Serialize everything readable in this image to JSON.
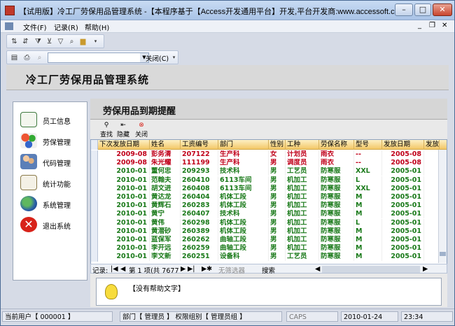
{
  "window": {
    "title": "【试用版】冷工厂劳保用品管理系统 -【本程序基于【Access开发通用平台】开发,平台开发商:www.accessoft.com】-[控...",
    "min": "–",
    "max": "□",
    "close": "✕"
  },
  "menu": {
    "file": "文件(F)",
    "record": "记录(R)",
    "help": "帮助(H)",
    "mdi_min": "_",
    "mdi_restore": "❐",
    "mdi_close": "✕"
  },
  "toolbar2": {
    "close_label": "关闭(C)"
  },
  "app_title": "冷工厂劳保用品管理系统",
  "nav": [
    {
      "label": "员工信息",
      "icon": "certificate-icon"
    },
    {
      "label": "劳保管理",
      "icon": "molecule-icon"
    },
    {
      "label": "代码管理",
      "icon": "users-icon"
    },
    {
      "label": "统计功能",
      "icon": "pencil-chart-icon"
    },
    {
      "label": "系统管理",
      "icon": "globe-icon"
    },
    {
      "label": "退出系统",
      "icon": "exit-icon"
    }
  ],
  "pane": {
    "title": "劳保用品到期提醒",
    "actions": [
      {
        "label": "查找"
      },
      {
        "label": "隐藏"
      },
      {
        "label": "关闭"
      }
    ]
  },
  "grid": {
    "columns": [
      "下次发放日期",
      "姓名",
      "工资编号",
      "部门",
      "性别",
      "工种",
      "劳保名称",
      "型号",
      "发放日期",
      "发放"
    ],
    "rows": [
      [
        "2009-08",
        "彭务清",
        "207122",
        "生产科",
        "女",
        "计划员",
        "雨衣",
        "--",
        "2005-08"
      ],
      [
        "2009-08",
        "朱光耀",
        "111199",
        "生产科",
        "男",
        "调度员",
        "雨衣",
        "--",
        "2005-08"
      ],
      [
        "2010-01",
        "董何忠",
        "209293",
        "技术科",
        "男",
        "工艺员",
        "防寒服",
        "XXL",
        "2005-01"
      ],
      [
        "2010-01",
        "范翰夫",
        "260410",
        "6113车间",
        "男",
        "机加工",
        "防寒服",
        "L",
        "2005-01"
      ],
      [
        "2010-01",
        "胡文进",
        "260408",
        "6113车间",
        "男",
        "机加工",
        "防寒服",
        "XXL",
        "2005-01"
      ],
      [
        "2010-01",
        "黄达龙",
        "260404",
        "机体工段",
        "男",
        "机加工",
        "防寒服",
        "M",
        "2005-01"
      ],
      [
        "2010-01",
        "黄辉石",
        "260283",
        "机体工段",
        "男",
        "机加工",
        "防寒服",
        "M",
        "2005-01"
      ],
      [
        "2010-01",
        "黄宁",
        "260407",
        "技术科",
        "男",
        "机加工",
        "防寒服",
        "M",
        "2005-01"
      ],
      [
        "2010-01",
        "黄伟",
        "260298",
        "机体工段",
        "男",
        "机加工",
        "防寒服",
        "L",
        "2005-01"
      ],
      [
        "2010-01",
        "黄潜砂",
        "260389",
        "机体工段",
        "男",
        "机加工",
        "防寒服",
        "M",
        "2005-01"
      ],
      [
        "2010-01",
        "蓝保军",
        "260262",
        "曲轴工段",
        "男",
        "机加工",
        "防寒服",
        "M",
        "2005-01"
      ],
      [
        "2010-01",
        "李开远",
        "260259",
        "曲轴工段",
        "男",
        "机加工",
        "防寒服",
        "M",
        "2005-01"
      ],
      [
        "2010-01",
        "李文新",
        "260251",
        "设备科",
        "男",
        "工艺员",
        "防寒服",
        "M",
        "2005-01"
      ]
    ],
    "row_colors": [
      "#c0001a",
      "#c0001a",
      "#1a7a1a",
      "#1a7a1a",
      "#1a7a1a",
      "#1a7a1a",
      "#1a7a1a",
      "#1a7a1a",
      "#1a7a1a",
      "#1a7a1a",
      "#1a7a1a",
      "#1a7a1a",
      "#1a7a1a"
    ]
  },
  "record_nav": {
    "label": "记录:",
    "position": "第 1 项(共 7677",
    "filter": "无筛选器",
    "search": "搜索"
  },
  "help_text": "【没有帮助文字】",
  "status": {
    "user": "当前用户【  000001  】",
    "dept": "部门【 管理员 】 权限组别【 管理员组 】",
    "caps": "CAPS",
    "date": "2010-01-24",
    "time": "23:34"
  }
}
